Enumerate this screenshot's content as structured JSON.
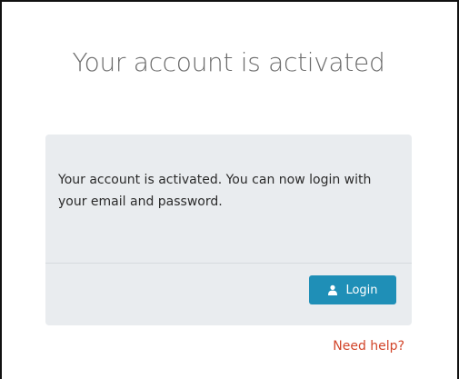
{
  "page": {
    "title": "Your account is activated"
  },
  "panel": {
    "message": "Your account is activated. You can now login with your email and password.",
    "login_button": {
      "label": "Login",
      "icon": "user-icon"
    }
  },
  "footer": {
    "help_link": "Need help?"
  },
  "colors": {
    "button": "#1f8fb7",
    "panel_background": "#e9ecef",
    "help_link": "#d2452a",
    "title_text": "#6b6b6b"
  }
}
